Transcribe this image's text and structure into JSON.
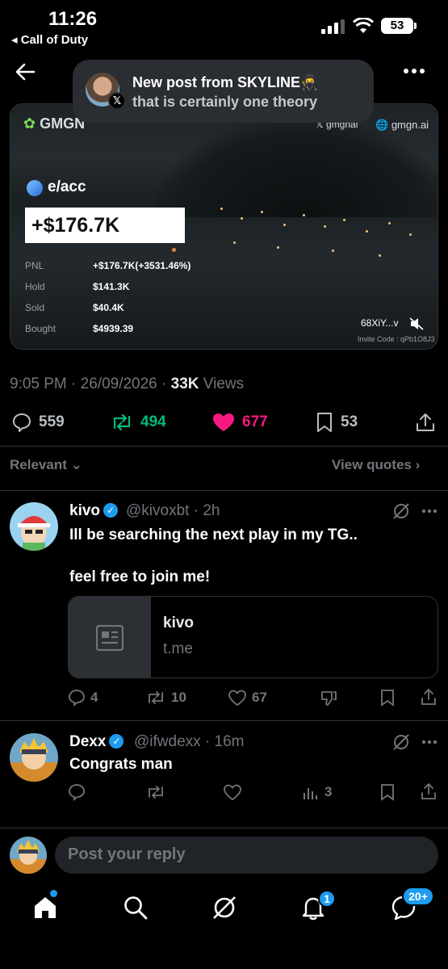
{
  "status_bar": {
    "time": "11:26",
    "back_app": "◂ Call of Duty",
    "battery": "53"
  },
  "toast": {
    "title": "New post from SKYLINE🥷",
    "subtitle": "that is certainly one theory"
  },
  "card": {
    "brand": "GMGN",
    "x_handle": "gmgnai",
    "site": "gmgn.ai",
    "token": "e/acc",
    "pnl_big": "+$176.7K",
    "stats": [
      {
        "label": "PNL",
        "value": "+$176.7K(+3531.46%)"
      },
      {
        "label": "Hold",
        "value": "$141.3K"
      },
      {
        "label": "Sold",
        "value": "$40.4K"
      },
      {
        "label": "Bought",
        "value": "$4939.39"
      }
    ],
    "user": "68XiY...v",
    "invite": "Invite Code : qPb1O8J3"
  },
  "post": {
    "time": "9:05 PM",
    "date": "26/09/2026",
    "views_count": "33K",
    "views_label": "Views",
    "dot": "·"
  },
  "actions": {
    "replies": "559",
    "reposts": "494",
    "likes": "677",
    "bookmarks": "53"
  },
  "filters": {
    "relevant": "Relevant",
    "view_quotes": "View quotes"
  },
  "replies": [
    {
      "name": "kivo",
      "handle": "@kivoxbt",
      "time": "2h",
      "line1": "Ill be searching the next play in my TG..",
      "line2": "feel free to join me!",
      "link_title": "kivo",
      "link_domain": "t.me",
      "replies": "4",
      "reposts": "10",
      "likes": "67"
    },
    {
      "name": "Dexx",
      "handle": "@ifwdexx",
      "time": "16m",
      "line1": "Congrats man",
      "views": "3"
    }
  ],
  "composer": {
    "placeholder": "Post your reply"
  },
  "nav": {
    "notifications_badge": "1",
    "messages_badge": "20+"
  },
  "colors": {
    "accent": "#1d9bf0",
    "repost": "#00ba7c",
    "like": "#f91880",
    "muted": "#71767b"
  }
}
